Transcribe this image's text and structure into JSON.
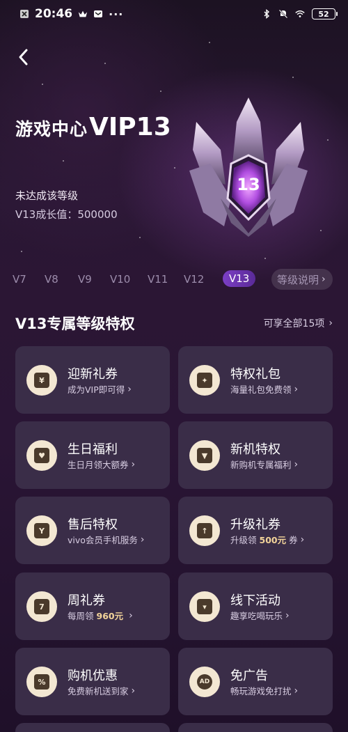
{
  "status_bar": {
    "time": "20:46",
    "battery": "52"
  },
  "hero": {
    "title_cn": "游戏中心",
    "title_vip": "VIP13",
    "status": "未达成该等级",
    "growth": "V13成长值：500000",
    "badge_number": "13"
  },
  "levels": {
    "items": [
      "V7",
      "V8",
      "V9",
      "V10",
      "V11",
      "V12",
      "V13"
    ],
    "active": "V13",
    "explain_label": "等级说明"
  },
  "section": {
    "title": "V13专属等级特权",
    "more": "可享全部15项"
  },
  "perks": [
    {
      "title": "迎新礼券",
      "subtitle": "成为VIP即可得",
      "icon": "yen-coupon-icon",
      "glyph": "¥"
    },
    {
      "title": "特权礼包",
      "subtitle": "海量礼包免费领",
      "icon": "gift-box-icon",
      "glyph": "✦"
    },
    {
      "title": "生日福利",
      "subtitle": "生日月领大额券",
      "icon": "birthday-cake-icon",
      "glyph": "♥"
    },
    {
      "title": "新机特权",
      "subtitle": "新购机专属福利",
      "icon": "new-phone-icon",
      "glyph": "▼"
    },
    {
      "title": "售后特权",
      "subtitle": "vivo会员手机服务",
      "icon": "wrench-shield-icon",
      "glyph": "Y"
    },
    {
      "title": "升级礼券",
      "subtitle_pre": "升级领",
      "subtitle_hl": "500元",
      "subtitle_post": "券",
      "icon": "upgrade-coupon-icon",
      "glyph": "↑"
    },
    {
      "title": "周礼券",
      "subtitle_pre": "每周领",
      "subtitle_hl": "960元",
      "subtitle_post": "",
      "icon": "weekly-coupon-icon",
      "glyph": "7"
    },
    {
      "title": "线下活动",
      "subtitle": "趣享吃喝玩乐",
      "icon": "offline-event-icon",
      "glyph": "▾"
    },
    {
      "title": "购机优惠",
      "subtitle": "免费新机送到家",
      "icon": "purchase-discount-icon",
      "glyph": "%"
    },
    {
      "title": "免广告",
      "subtitle": "畅玩游戏免打扰",
      "icon": "ad-free-icon",
      "glyph": "AD"
    }
  ],
  "colors": {
    "card_bg": "#3a2d48",
    "accent": "#7b3fc4",
    "icon_bg": "#f3e7d2",
    "highlight": "#f3d49a"
  }
}
